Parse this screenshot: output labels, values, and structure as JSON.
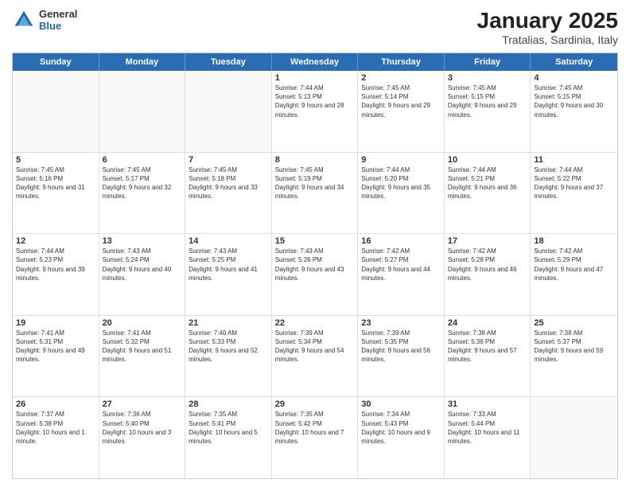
{
  "header": {
    "logo_general": "General",
    "logo_blue": "Blue",
    "main_title": "January 2025",
    "subtitle": "Tratalias, Sardinia, Italy"
  },
  "calendar": {
    "days_of_week": [
      "Sunday",
      "Monday",
      "Tuesday",
      "Wednesday",
      "Thursday",
      "Friday",
      "Saturday"
    ],
    "rows": [
      [
        {
          "day": "",
          "text": ""
        },
        {
          "day": "",
          "text": ""
        },
        {
          "day": "",
          "text": ""
        },
        {
          "day": "1",
          "text": "Sunrise: 7:44 AM\nSunset: 5:13 PM\nDaylight: 9 hours and 28 minutes."
        },
        {
          "day": "2",
          "text": "Sunrise: 7:45 AM\nSunset: 5:14 PM\nDaylight: 9 hours and 29 minutes."
        },
        {
          "day": "3",
          "text": "Sunrise: 7:45 AM\nSunset: 5:15 PM\nDaylight: 9 hours and 29 minutes."
        },
        {
          "day": "4",
          "text": "Sunrise: 7:45 AM\nSunset: 5:15 PM\nDaylight: 9 hours and 30 minutes."
        }
      ],
      [
        {
          "day": "5",
          "text": "Sunrise: 7:45 AM\nSunset: 5:16 PM\nDaylight: 9 hours and 31 minutes."
        },
        {
          "day": "6",
          "text": "Sunrise: 7:45 AM\nSunset: 5:17 PM\nDaylight: 9 hours and 32 minutes."
        },
        {
          "day": "7",
          "text": "Sunrise: 7:45 AM\nSunset: 5:18 PM\nDaylight: 9 hours and 33 minutes."
        },
        {
          "day": "8",
          "text": "Sunrise: 7:45 AM\nSunset: 5:19 PM\nDaylight: 9 hours and 34 minutes."
        },
        {
          "day": "9",
          "text": "Sunrise: 7:44 AM\nSunset: 5:20 PM\nDaylight: 9 hours and 35 minutes."
        },
        {
          "day": "10",
          "text": "Sunrise: 7:44 AM\nSunset: 5:21 PM\nDaylight: 9 hours and 36 minutes."
        },
        {
          "day": "11",
          "text": "Sunrise: 7:44 AM\nSunset: 5:22 PM\nDaylight: 9 hours and 37 minutes."
        }
      ],
      [
        {
          "day": "12",
          "text": "Sunrise: 7:44 AM\nSunset: 5:23 PM\nDaylight: 9 hours and 39 minutes."
        },
        {
          "day": "13",
          "text": "Sunrise: 7:43 AM\nSunset: 5:24 PM\nDaylight: 9 hours and 40 minutes."
        },
        {
          "day": "14",
          "text": "Sunrise: 7:43 AM\nSunset: 5:25 PM\nDaylight: 9 hours and 41 minutes."
        },
        {
          "day": "15",
          "text": "Sunrise: 7:43 AM\nSunset: 5:26 PM\nDaylight: 9 hours and 43 minutes."
        },
        {
          "day": "16",
          "text": "Sunrise: 7:42 AM\nSunset: 5:27 PM\nDaylight: 9 hours and 44 minutes."
        },
        {
          "day": "17",
          "text": "Sunrise: 7:42 AM\nSunset: 5:28 PM\nDaylight: 9 hours and 46 minutes."
        },
        {
          "day": "18",
          "text": "Sunrise: 7:42 AM\nSunset: 5:29 PM\nDaylight: 9 hours and 47 minutes."
        }
      ],
      [
        {
          "day": "19",
          "text": "Sunrise: 7:41 AM\nSunset: 5:31 PM\nDaylight: 9 hours and 49 minutes."
        },
        {
          "day": "20",
          "text": "Sunrise: 7:41 AM\nSunset: 5:32 PM\nDaylight: 9 hours and 51 minutes."
        },
        {
          "day": "21",
          "text": "Sunrise: 7:40 AM\nSunset: 5:33 PM\nDaylight: 9 hours and 52 minutes."
        },
        {
          "day": "22",
          "text": "Sunrise: 7:39 AM\nSunset: 5:34 PM\nDaylight: 9 hours and 54 minutes."
        },
        {
          "day": "23",
          "text": "Sunrise: 7:39 AM\nSunset: 5:35 PM\nDaylight: 9 hours and 56 minutes."
        },
        {
          "day": "24",
          "text": "Sunrise: 7:38 AM\nSunset: 5:36 PM\nDaylight: 9 hours and 57 minutes."
        },
        {
          "day": "25",
          "text": "Sunrise: 7:38 AM\nSunset: 5:37 PM\nDaylight: 9 hours and 59 minutes."
        }
      ],
      [
        {
          "day": "26",
          "text": "Sunrise: 7:37 AM\nSunset: 5:38 PM\nDaylight: 10 hours and 1 minute."
        },
        {
          "day": "27",
          "text": "Sunrise: 7:36 AM\nSunset: 5:40 PM\nDaylight: 10 hours and 3 minutes."
        },
        {
          "day": "28",
          "text": "Sunrise: 7:35 AM\nSunset: 5:41 PM\nDaylight: 10 hours and 5 minutes."
        },
        {
          "day": "29",
          "text": "Sunrise: 7:35 AM\nSunset: 5:42 PM\nDaylight: 10 hours and 7 minutes."
        },
        {
          "day": "30",
          "text": "Sunrise: 7:34 AM\nSunset: 5:43 PM\nDaylight: 10 hours and 9 minutes."
        },
        {
          "day": "31",
          "text": "Sunrise: 7:33 AM\nSunset: 5:44 PM\nDaylight: 10 hours and 11 minutes."
        },
        {
          "day": "",
          "text": ""
        }
      ]
    ]
  }
}
